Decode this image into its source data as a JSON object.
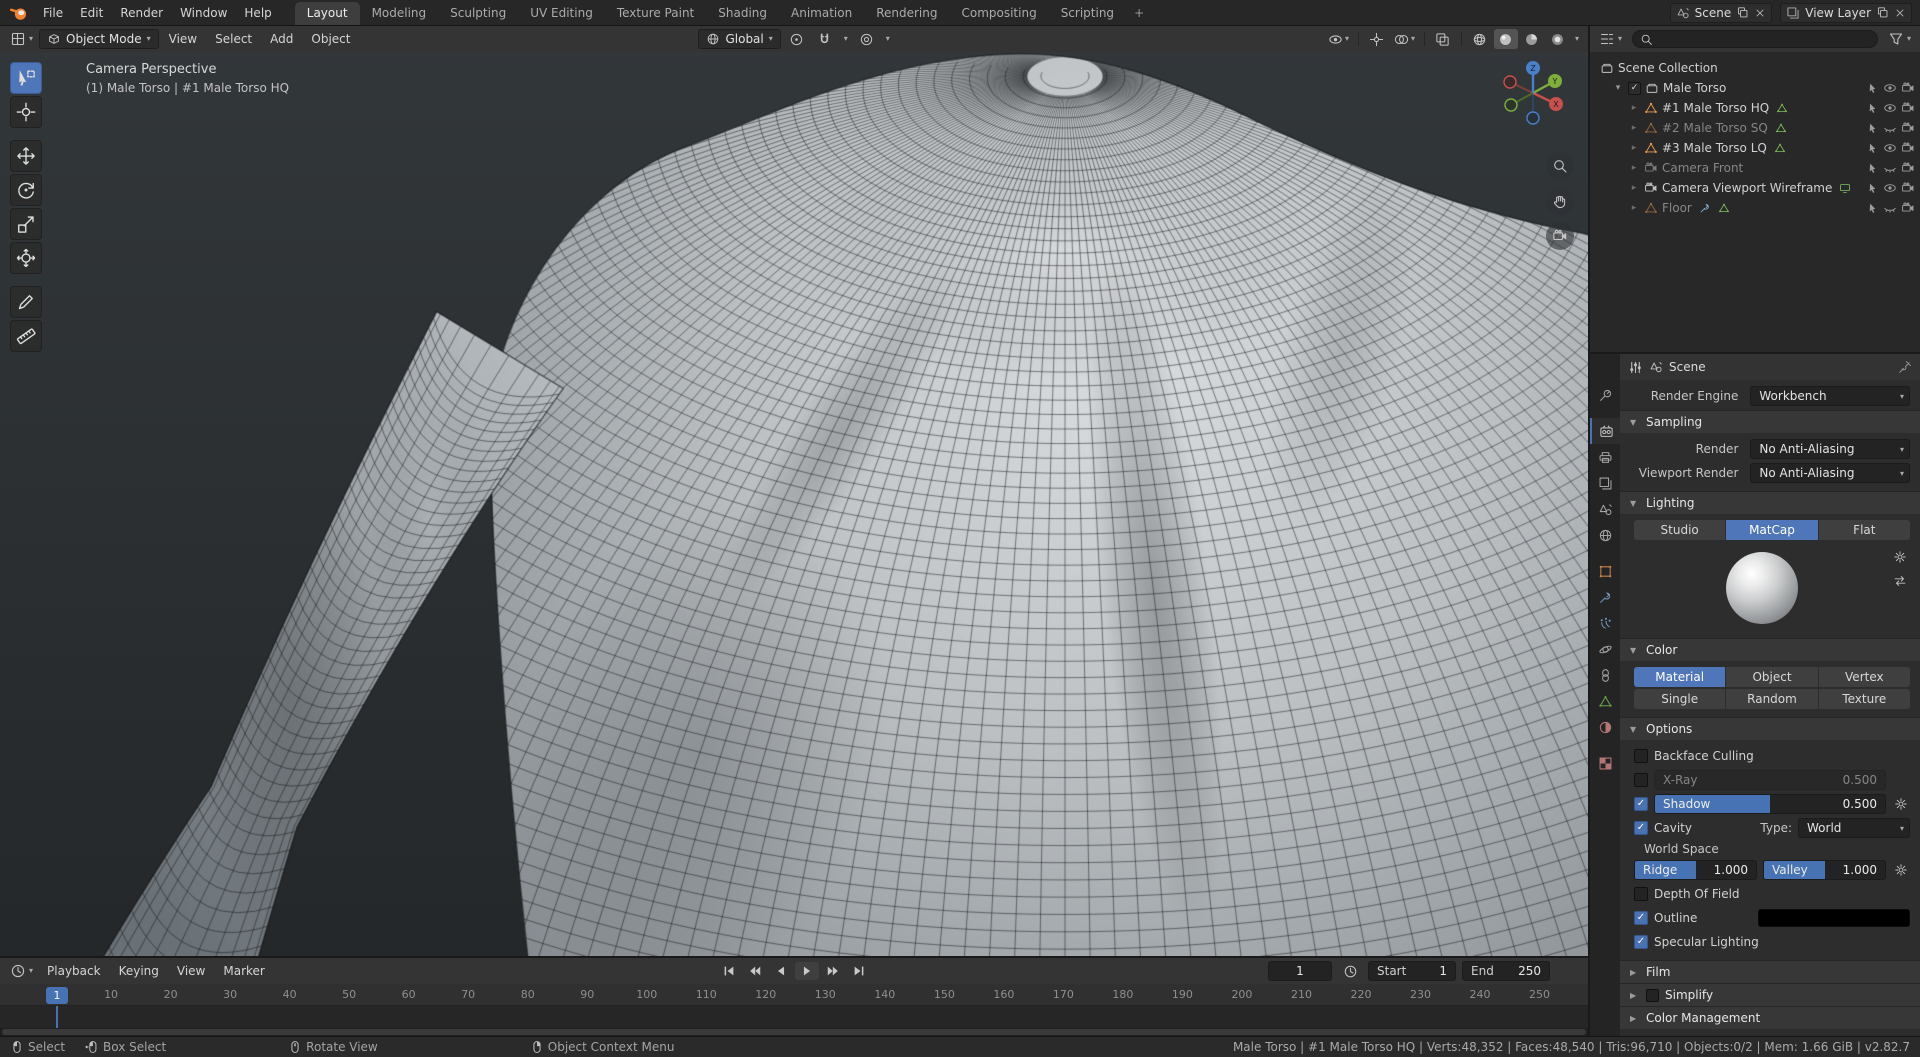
{
  "topbar": {
    "menus": [
      "File",
      "Edit",
      "Render",
      "Window",
      "Help"
    ],
    "tabs": [
      "Layout",
      "Modeling",
      "Sculpting",
      "UV Editing",
      "Texture Paint",
      "Shading",
      "Animation",
      "Rendering",
      "Compositing",
      "Scripting"
    ],
    "new_tab": "+",
    "scene": "Scene",
    "view_layer": "View Layer"
  },
  "viewport": {
    "mode": "Object Mode",
    "menus": [
      "View",
      "Select",
      "Add",
      "Object"
    ],
    "orientation": "Global",
    "view_label": "Camera Perspective",
    "object_label": "(1) Male Torso | #1 Male Torso HQ",
    "axis_labels": [
      "X",
      "Y",
      "Z"
    ]
  },
  "outliner": {
    "search_value": "",
    "root": "Scene Collection",
    "collection": "Male Torso",
    "items": [
      {
        "label": "#1 Male Torso HQ",
        "type": "mesh",
        "visible": true
      },
      {
        "label": "#2 Male Torso SQ",
        "type": "mesh",
        "visible": false
      },
      {
        "label": "#3 Male Torso LQ",
        "type": "mesh",
        "visible": true
      },
      {
        "label": "Camera Front",
        "type": "camera",
        "visible": false
      },
      {
        "label": "Camera Viewport Wireframe",
        "type": "camera",
        "visible": true
      },
      {
        "label": "Floor",
        "type": "mesh",
        "visible": false
      }
    ]
  },
  "properties": {
    "breadcrumb": "Scene",
    "tabs": [
      "tool",
      "render",
      "output",
      "view-layer",
      "scene",
      "world",
      "object",
      "modifiers",
      "particles",
      "physics",
      "constraints",
      "object-data",
      "material",
      "texture"
    ],
    "active_tab": "render",
    "render_engine_label": "Render Engine",
    "render_engine_value": "Workbench",
    "sampling": {
      "title": "Sampling",
      "rows": [
        {
          "label": "Render",
          "value": "No Anti-Aliasing"
        },
        {
          "label": "Viewport Render",
          "value": "No Anti-Aliasing"
        }
      ]
    },
    "lighting": {
      "title": "Lighting",
      "modes": [
        "Studio",
        "MatCap",
        "Flat"
      ],
      "active": "MatCap"
    },
    "color": {
      "title": "Color",
      "row1": [
        "Material",
        "Object",
        "Vertex"
      ],
      "row2": [
        "Single",
        "Random",
        "Texture"
      ],
      "active": "Material"
    },
    "options": {
      "title": "Options",
      "backface_culling": "Backface Culling",
      "xray_label": "X-Ray",
      "xray_value": "0.500",
      "shadow_label": "Shadow",
      "shadow_value": "0.500",
      "cavity": "Cavity",
      "type_label": "Type:",
      "type_value": "World",
      "world_space": "World Space",
      "ridge_label": "Ridge",
      "ridge_value": "1.000",
      "valley_label": "Valley",
      "valley_value": "1.000",
      "depth_of_field": "Depth Of Field",
      "outline": "Outline",
      "outline_color": "#000000",
      "specular_lighting": "Specular Lighting"
    },
    "film": "Film",
    "simplify": "Simplify",
    "color_management": "Color Management"
  },
  "timeline": {
    "menus": [
      "Playback",
      "Keying",
      "View",
      "Marker"
    ],
    "current_frame": "1",
    "start_label": "Start",
    "start_value": "1",
    "end_label": "End",
    "end_value": "250",
    "ticks": [
      1,
      10,
      20,
      30,
      40,
      50,
      60,
      70,
      80,
      90,
      100,
      110,
      120,
      130,
      140,
      150,
      160,
      170,
      180,
      190,
      200,
      210,
      220,
      230,
      240,
      250
    ]
  },
  "statusbar": {
    "items": [
      {
        "icon": "mouse-left",
        "label": "Select"
      },
      {
        "icon": "mouse-drag",
        "label": "Box Select"
      },
      {
        "icon": "mouse-middle",
        "label": "Rotate View"
      },
      {
        "icon": "mouse-right",
        "label": "Object Context Menu"
      }
    ],
    "stats": "Male Torso | #1 Male Torso HQ | Verts:48,352 | Faces:48,540 | Tris:96,710 | Objects:0/2 | Mem: 1.66 GiB | v2.82.7"
  },
  "colors": {
    "accent": "#4772b3",
    "selected": "#5680c2",
    "mesh_orange": "#ec9b55",
    "data_green": "#7fc35a",
    "viewport_bg": "#292c2e"
  }
}
